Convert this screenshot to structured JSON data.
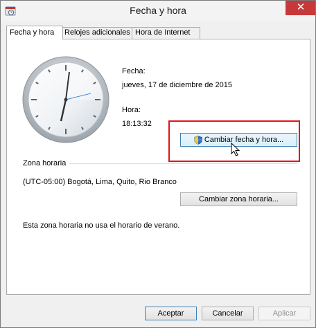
{
  "window": {
    "title": "Fecha y hora",
    "close_glyph": "✕"
  },
  "tabs": [
    {
      "label": "Fecha y hora",
      "active": true
    },
    {
      "label": "Relojes adicionales",
      "active": false
    },
    {
      "label": "Hora de Internet",
      "active": false
    }
  ],
  "date": {
    "label": "Fecha:",
    "value": "jueves, 17 de diciembre de 2015"
  },
  "time": {
    "label": "Hora:",
    "value": "18:13:32"
  },
  "change_datetime_button": "Cambiar fecha y hora...",
  "timezone": {
    "group_label": "Zona horaria",
    "value": "(UTC-05:00) Bogotá, Lima, Quito, Rio Branco",
    "change_button": "Cambiar zona horaria..."
  },
  "dst_note": "Esta zona horaria no usa el horario de verano.",
  "footer": {
    "accept": "Aceptar",
    "cancel": "Cancelar",
    "apply": "Aplicar"
  },
  "icons": {
    "app": "clock-icon",
    "uac": "uac-shield-icon",
    "cursor": "mouse-pointer-icon"
  },
  "colors": {
    "highlight": "#e0141a",
    "close": "#c7383a"
  }
}
